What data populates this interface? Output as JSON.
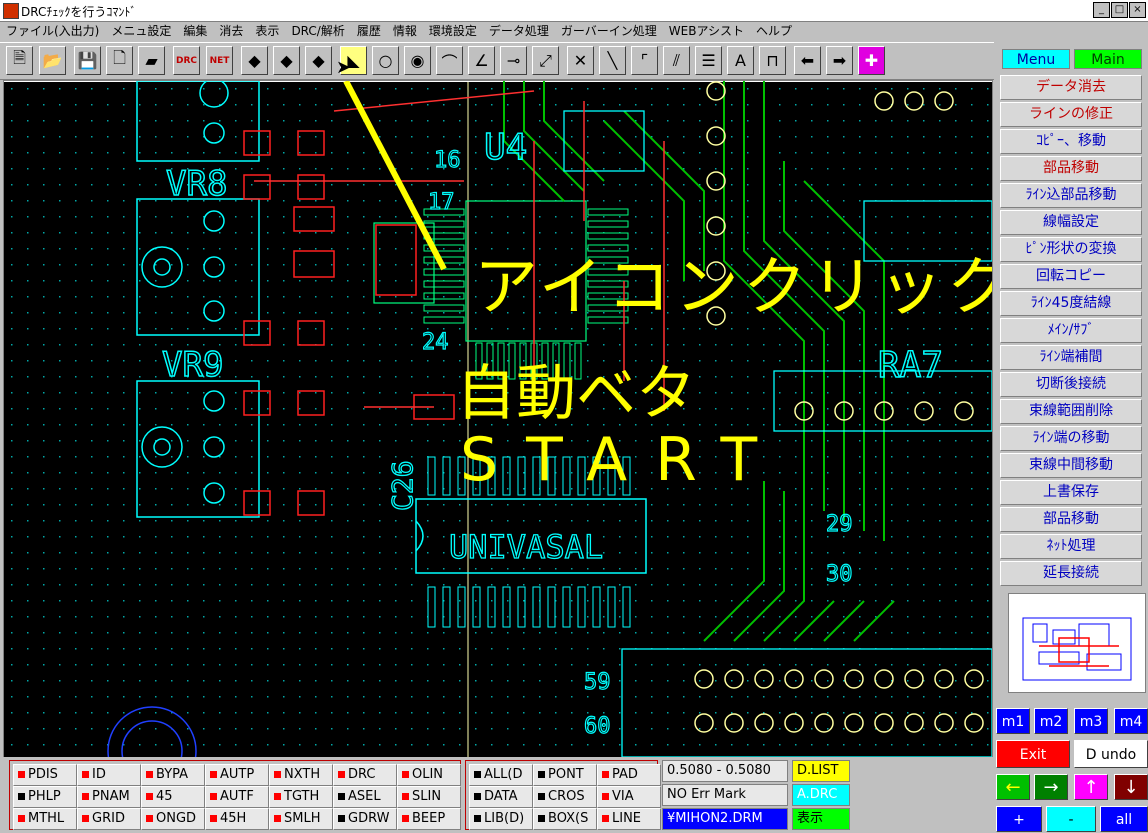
{
  "window": {
    "title": "DRCﾁｪｯｸを行うｺﾏﾝﾄﾞ",
    "min_glyph": "_",
    "max_glyph": "□",
    "close_glyph": "×"
  },
  "menu": [
    "ファイル(入出力)",
    "メニュ設定",
    "編集",
    "消去",
    "表示",
    "DRC/解析",
    "履歴",
    "情報",
    "環境設定",
    "データ処理",
    "ガーバーイン処理",
    "WEBアシスト",
    "ヘルプ"
  ],
  "toolbar": [
    {
      "icon": "file-list-icon",
      "glyph": "🗎"
    },
    {
      "icon": "open-folder-icon",
      "glyph": "📂"
    },
    {
      "icon": "save-icon",
      "glyph": "💾"
    },
    {
      "icon": "new-page-icon",
      "glyph": "🗋"
    },
    {
      "icon": "chip-folder-icon",
      "glyph": "▰"
    },
    {
      "icon": "drc-icon",
      "glyph": "DRC"
    },
    {
      "icon": "net-icon",
      "glyph": "NET"
    },
    {
      "icon": "part-icon",
      "glyph": "◆"
    },
    {
      "icon": "part-save-icon",
      "glyph": "◆"
    },
    {
      "icon": "part-settings-icon",
      "glyph": "◆"
    },
    {
      "icon": "auto-fill-icon",
      "glyph": "◣"
    },
    {
      "icon": "via-ring-icon",
      "glyph": "○"
    },
    {
      "icon": "pad-icon",
      "glyph": "◉"
    },
    {
      "icon": "arc-icon",
      "glyph": "⌒"
    },
    {
      "icon": "angle-icon",
      "glyph": "∠"
    },
    {
      "icon": "probe-icon",
      "glyph": "⊸"
    },
    {
      "icon": "connect-icon",
      "glyph": "⤢"
    },
    {
      "icon": "line-cut-icon",
      "glyph": "✕"
    },
    {
      "icon": "diagonal-line-icon",
      "glyph": "╲"
    },
    {
      "icon": "corner-icon",
      "glyph": "⌜"
    },
    {
      "icon": "bus-line-icon",
      "glyph": "⫽"
    },
    {
      "icon": "align-icon",
      "glyph": "☰"
    },
    {
      "icon": "text-icon",
      "glyph": "A"
    },
    {
      "icon": "dimension-icon",
      "glyph": "⊓"
    },
    {
      "icon": "arrow-left-icon",
      "glyph": "⬅"
    },
    {
      "icon": "arrow-right-icon",
      "glyph": "➡"
    },
    {
      "icon": "cross-cursor-icon",
      "glyph": "✚"
    }
  ],
  "overlay": {
    "line1": "アイコンクリック",
    "line2": "自動ベタ",
    "line3": "START"
  },
  "board_labels": [
    "VR8",
    "VR9",
    "U4",
    "RA7",
    "16",
    "17",
    "24",
    "29",
    "30",
    "59",
    "60",
    "C26",
    "UNIVASAL"
  ],
  "right_panel": {
    "tabs": [
      "Menu",
      "Main"
    ],
    "commands": [
      "データ消去",
      "ラインの修正",
      "ｺﾋﾟｰ、移動",
      "部品移動",
      "ﾗｲﾝ込部品移動",
      "線幅設定",
      "ﾋﾟﾝ形状の変換",
      "回転コピー",
      "ﾗｲﾝ45度結線",
      "ﾒｲﾝ/ｻﾌﾞ",
      "ﾗｲﾝ端補間",
      "切断後接続",
      "束線範囲削除",
      "ﾗｲﾝ端の移動",
      "束線中間移動",
      "上書保存",
      "部品移動",
      "ﾈｯﾄ処理",
      "延長接続"
    ]
  },
  "mode_buttons": [
    "m1",
    "m2",
    "m3",
    "m4"
  ],
  "control": {
    "exit": "Exit",
    "undo": "D undo",
    "arrow_left": "←",
    "arrow_right": "→",
    "arrow_up": "↑",
    "arrow_down": "↓",
    "plus": "+",
    "minus": "-",
    "all": "all"
  },
  "status": {
    "group1": [
      [
        "PDIS",
        "ID",
        "BYPA",
        "AUTP",
        "NXTH",
        "DRC",
        "OLIN"
      ],
      [
        "PHLP",
        "PNAM",
        "45",
        "AUTF",
        "TGTH",
        "ASEL",
        "SLIN"
      ],
      [
        "MTHL",
        "GRID",
        "ONGD",
        "45H",
        "SMLH",
        "GDRW",
        "BEEP"
      ]
    ],
    "group2": [
      [
        "ALL(D",
        "PONT",
        "PAD"
      ],
      [
        "DATA",
        "CROS",
        "VIA"
      ],
      [
        "LIB(D)",
        "BOX(S",
        "LINE"
      ]
    ],
    "coord": "0.5080 - 0.5080",
    "err": "NO Err Mark",
    "file": "¥MIHON2.DRM",
    "dlist": "D.LIST",
    "adrc": "A.DRC",
    "hyoji": "表示"
  },
  "colors": {
    "accent_red": "#ff0000",
    "cmd_red": "#c00000",
    "cmd_blue": "#0000c0",
    "overlay_yellow": "#ffff00",
    "menu_tab": "#00ffff",
    "main_tab": "#00ff00"
  }
}
